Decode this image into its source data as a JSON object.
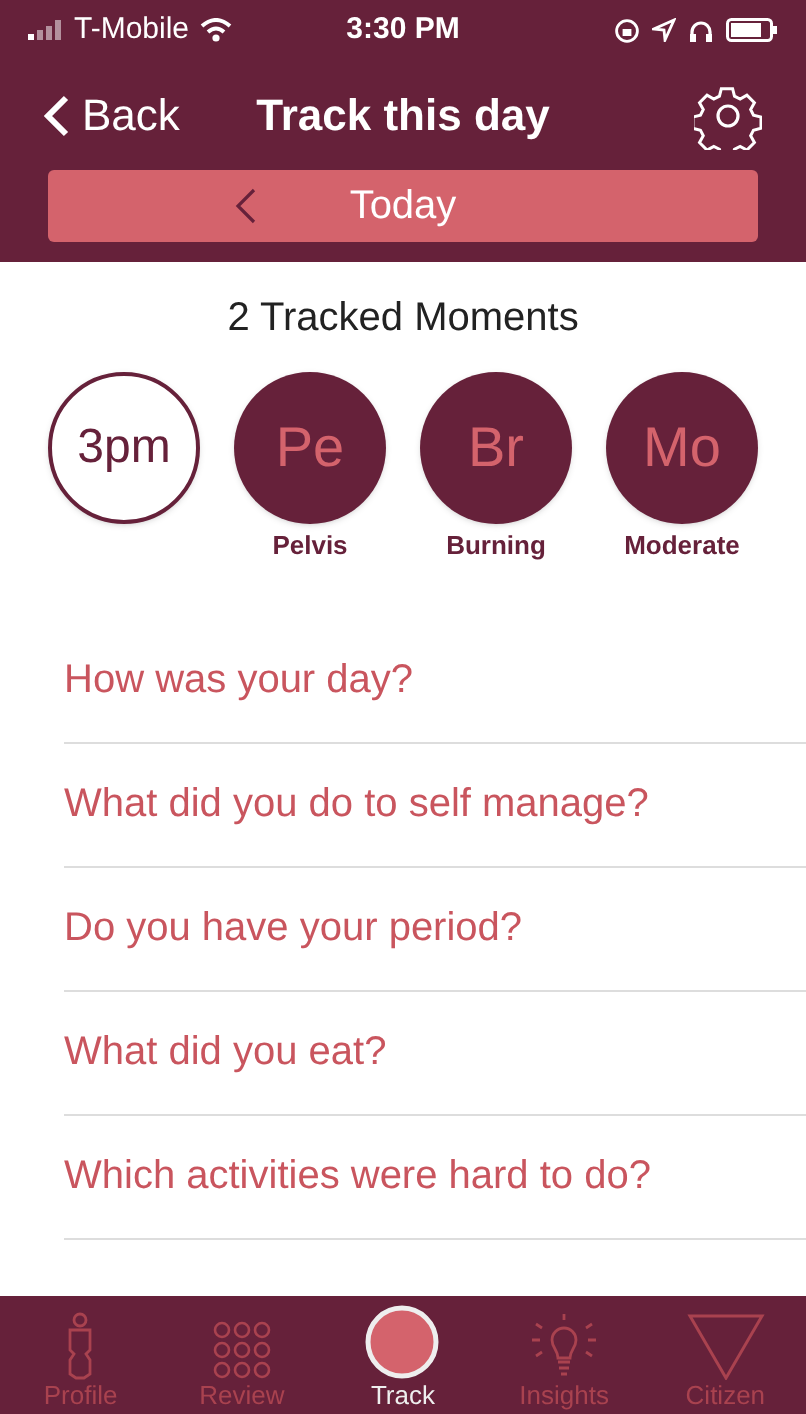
{
  "status_bar": {
    "carrier": "T-Mobile",
    "time": "3:30 PM"
  },
  "nav": {
    "back": "Back",
    "title": "Track this day"
  },
  "date_bar": {
    "label": "Today"
  },
  "moments_title": "2 Tracked Moments",
  "moments": [
    {
      "kind": "time",
      "text": "3pm"
    },
    {
      "kind": "tag",
      "text": "Pe",
      "label": "Pelvis"
    },
    {
      "kind": "tag",
      "text": "Br",
      "label": "Burning"
    },
    {
      "kind": "tag",
      "text": "Mo",
      "label": "Moderate"
    }
  ],
  "questions": [
    "How was your day?",
    "What did you do to self manage?",
    "Do you have your period?",
    "What did you eat?",
    "Which activities were hard to do?"
  ],
  "tab_bar": [
    {
      "kind": "profile",
      "label": "Profile",
      "selected": false
    },
    {
      "kind": "review",
      "label": "Review",
      "selected": false
    },
    {
      "kind": "track",
      "label": "Track",
      "selected": true
    },
    {
      "kind": "insights",
      "label": "Insights",
      "selected": false
    },
    {
      "kind": "citizen",
      "label": "Citizen",
      "selected": false
    }
  ]
}
